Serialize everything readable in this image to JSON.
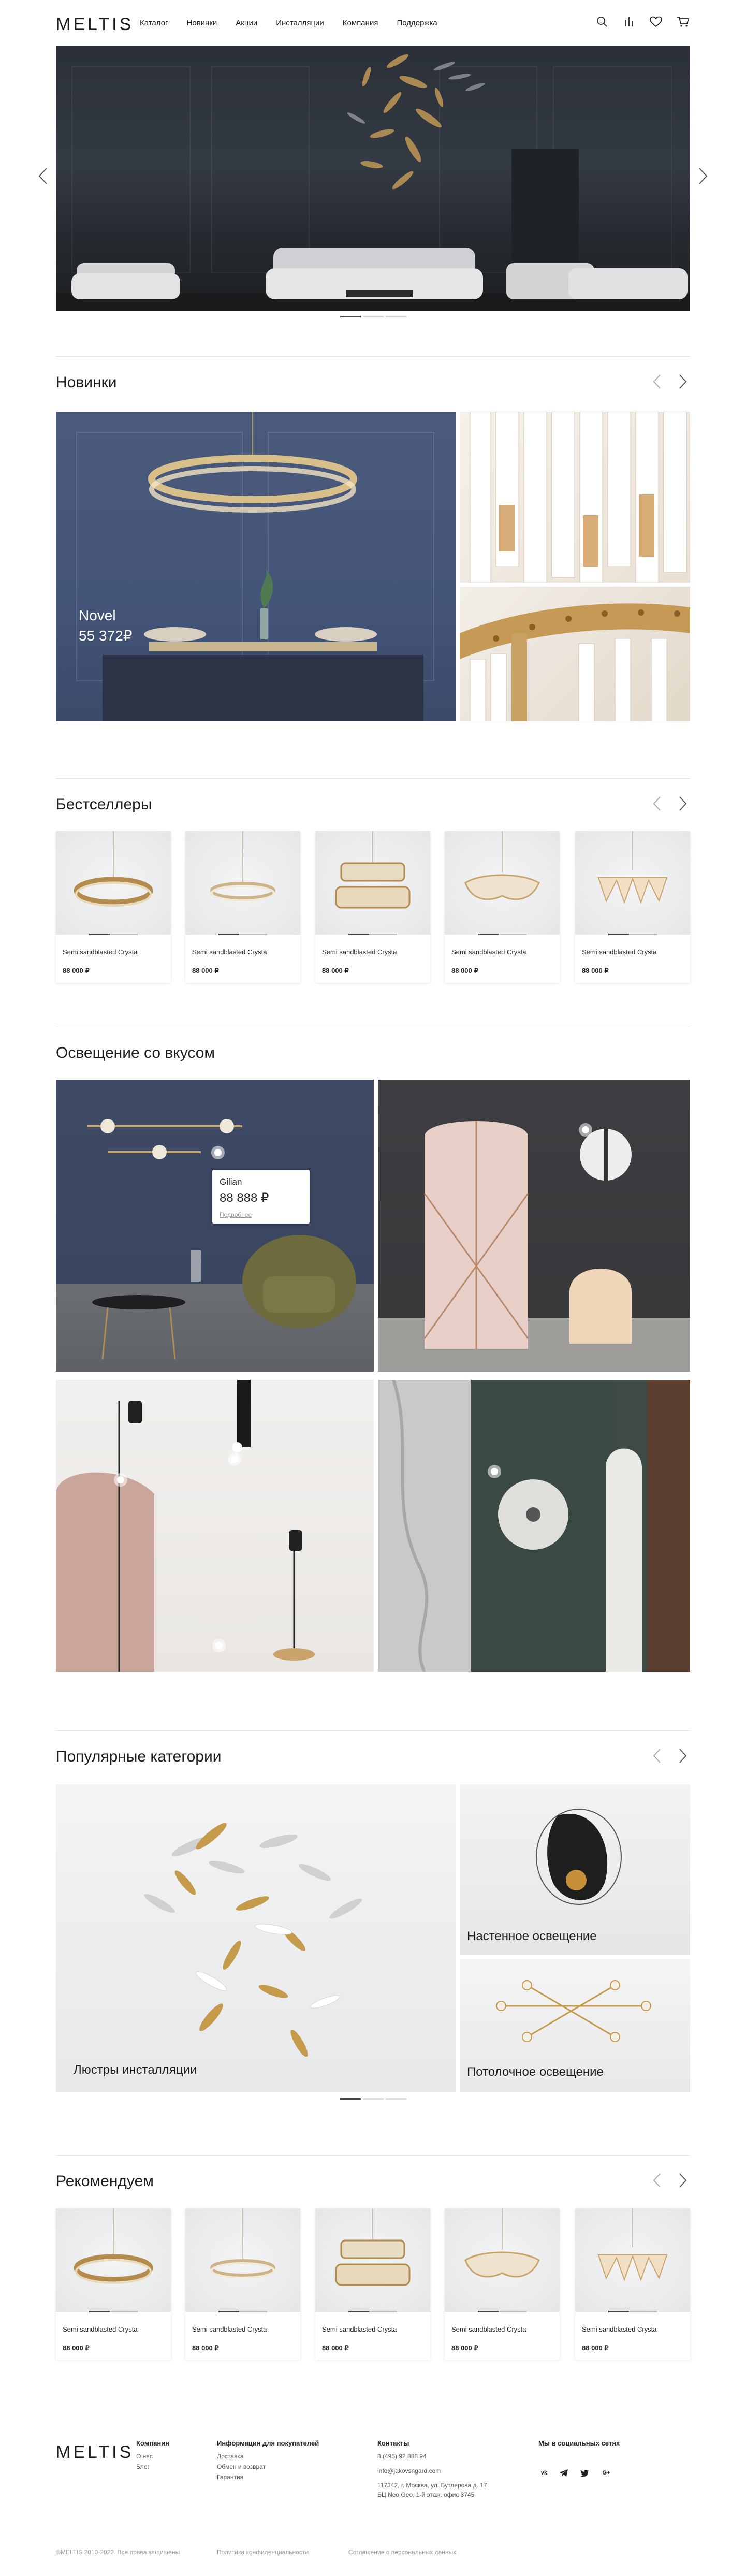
{
  "brand": {
    "logo": "MELTIS"
  },
  "nav": [
    "Каталог",
    "Новинки",
    "Акции",
    "Инсталляции",
    "Компания",
    "Поддержка"
  ],
  "header_icons": [
    "search-icon",
    "compare-icon",
    "heart-icon",
    "cart-icon"
  ],
  "hero": {
    "slides": 3,
    "active_slide": 1
  },
  "novelties": {
    "title": "Новинки",
    "feature": {
      "name": "Novel",
      "price": "55 372₽"
    }
  },
  "bestsellers": {
    "title": "Бестселлеры",
    "products": [
      {
        "name": "Semi sandblasted Crysta",
        "price": "88 000 ₽"
      },
      {
        "name": "Semi sandblasted Crysta",
        "price": "88 000 ₽"
      },
      {
        "name": "Semi sandblasted Crysta",
        "price": "88 000 ₽"
      },
      {
        "name": "Semi sandblasted Crysta",
        "price": "88 000 ₽"
      },
      {
        "name": "Semi sandblasted Crysta",
        "price": "88 000 ₽"
      }
    ]
  },
  "taste": {
    "title": "Освещение со вкусом",
    "popup": {
      "name": "Gilian",
      "price": "88 888 ₽",
      "link": "Подробнее"
    }
  },
  "categories": {
    "title": "Популярные категории",
    "items": [
      "Люстры инсталляции",
      "Настенное освещение",
      "Потолочное освещение"
    ]
  },
  "recommend": {
    "title": "Рекомендуем",
    "products": [
      {
        "name": "Semi sandblasted Crysta",
        "price": "88 000 ₽"
      },
      {
        "name": "Semi sandblasted Crysta",
        "price": "88 000 ₽"
      },
      {
        "name": "Semi sandblasted Crysta",
        "price": "88 000 ₽"
      },
      {
        "name": "Semi sandblasted Crysta",
        "price": "88 000 ₽"
      },
      {
        "name": "Semi sandblasted Crysta",
        "price": "88 000 ₽"
      }
    ]
  },
  "footer": {
    "company": {
      "title": "Компания",
      "links": [
        "О нас",
        "Блог"
      ]
    },
    "buyers": {
      "title": "Информация для покупателей",
      "links": [
        "Доставка",
        "Обмен и возврат",
        "Гарантия"
      ]
    },
    "contacts": {
      "title": "Контакты",
      "phone": "8 (495) 92 888 94",
      "email": "info@jakovsngard.com",
      "address1": "117342, г. Москва, ул. Бутлерова д. 17",
      "address2": "БЦ Neo Geo, 1-й этаж, офис 3745"
    },
    "social": {
      "title": "Мы в социальных сетях",
      "icons": [
        "vk-icon",
        "telegram-icon",
        "twitter-icon",
        "google-plus-icon"
      ]
    },
    "copyright": "©MELTIS 2010-2022. Все права защищены",
    "privacy": "Политика конфиденциальности",
    "consent": "Соглашение о персональных данных"
  }
}
